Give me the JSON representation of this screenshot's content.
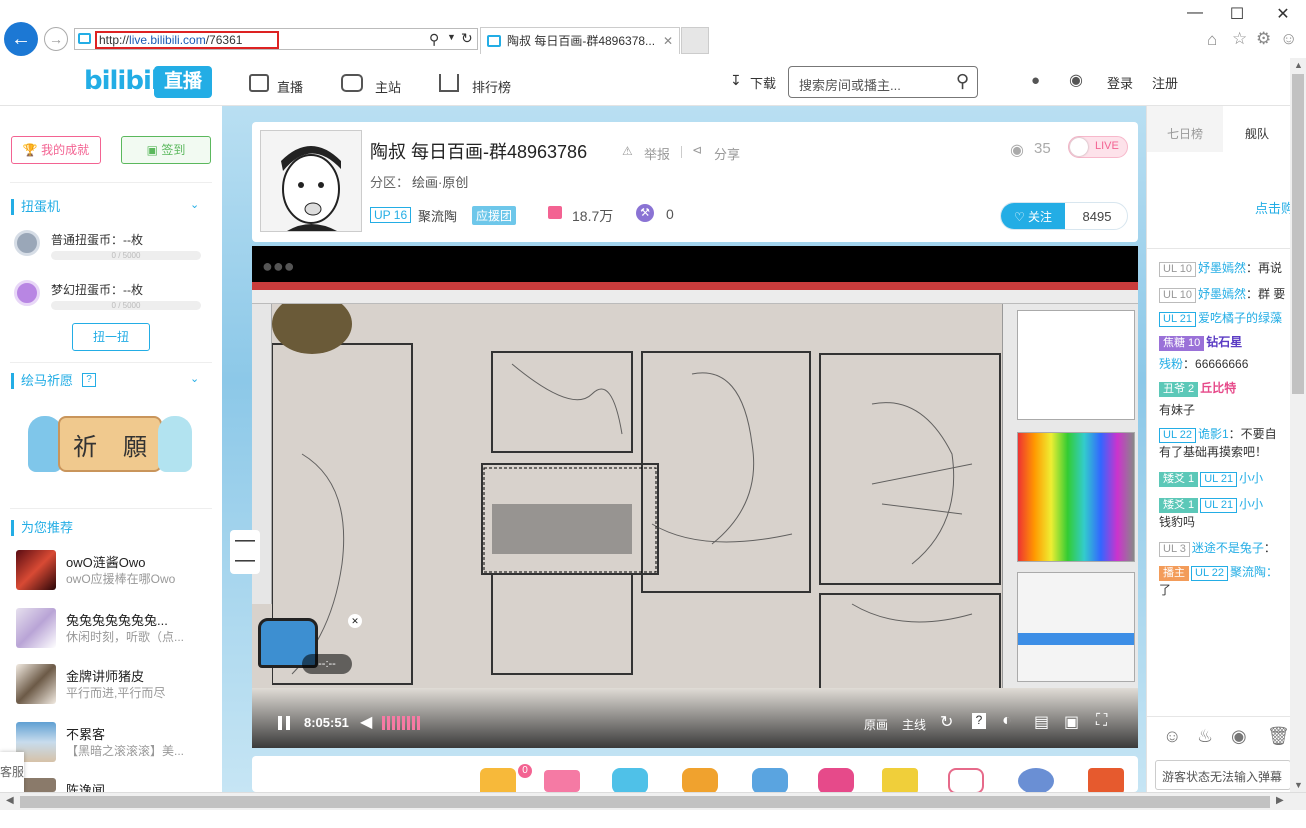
{
  "browser": {
    "url_prefix": "http://",
    "url_host": "live.bilibili.com",
    "url_path": "/76361",
    "tab_title": "陶叔 每日百画-群4896378...",
    "window_controls": [
      "—",
      "☐",
      "✕"
    ]
  },
  "header": {
    "logo_text": "bilibili",
    "logo_badge": "直播",
    "nav": [
      "直播",
      "主站",
      "排行榜"
    ],
    "download": "下载",
    "search_placeholder": "搜索房间或播主...",
    "login": "登录",
    "register": "注册"
  },
  "sidebar": {
    "achievements_button": "我的成就",
    "checkin_button": "签到",
    "gacha_title": "扭蛋机",
    "coins": [
      {
        "label": "普通扭蛋币：--枚",
        "progress_text": "0 / 5000",
        "progress": 0
      },
      {
        "label": "梦幻扭蛋币：--枚",
        "progress_text": "0 / 5000",
        "progress": 0
      }
    ],
    "twist_button": "扭一扭",
    "wish_title": "绘马祈愿",
    "wish_help": "?",
    "wish_plaque": [
      "祈",
      "願"
    ],
    "recommend_title": "为您推荐",
    "recommend": [
      {
        "name": "owO涟酱Owo",
        "sub": "owO应援棒在哪Owo"
      },
      {
        "name": "兔兔兔兔兔兔兔...",
        "sub": "休闲时刻，听歌（点..."
      },
      {
        "name": "金牌讲师猪皮",
        "sub": "平行而进,平行而尽"
      },
      {
        "name": "不累客",
        "sub": "【黑暗之滚滚滚】美..."
      },
      {
        "name": "陈逸闻",
        "sub": ""
      }
    ],
    "service_text": "客服"
  },
  "room": {
    "title": "陶叔 每日百画-群48963786",
    "report": "举报",
    "share": "分享",
    "category_label": "分区：",
    "category": "绘画·原创",
    "up_level": "UP 16",
    "up_name": "聚流陶",
    "guard_tag": "应援团",
    "gift_count": "18.7万",
    "tools_count": "0",
    "viewers": "35",
    "live_label": "LIVE",
    "follow_label": "关注",
    "follow_count": "8495"
  },
  "player": {
    "time": "8:05:51",
    "quality_buttons": [
      "原画",
      "主线"
    ],
    "chest_timer": "--:--",
    "gift_badge": "0"
  },
  "chat": {
    "tabs": [
      "七日榜",
      "舰队"
    ],
    "click_hint": "点击购",
    "messages": [
      {
        "badge": "UL 10",
        "user": "妤墨嫣然",
        "text": "：再说"
      },
      {
        "badge": "UL 10",
        "user": "妤墨嫣然",
        "text": "：群 要"
      },
      {
        "badge": "UL 21",
        "user": "爱吃橘子的绿藻",
        "text": ""
      },
      {
        "badge": "焦糖 10",
        "user": "",
        "text": "钻石星"
      },
      {
        "badge": "",
        "user": "残粉",
        "text": "：66666666"
      },
      {
        "badge": "丑爷 2",
        "user": "",
        "text": "丘比特"
      },
      {
        "badge": "",
        "user": "",
        "text": "有妹子"
      },
      {
        "badge": "UL 22",
        "user": "诡影1",
        "text": "：不要自"
      },
      {
        "badge": "",
        "user": "",
        "text": "有了基础再摸索吧！"
      },
      {
        "badge": "矮爻 1",
        "user": "UL 21",
        "text": "小小"
      },
      {
        "badge": "矮爻 1",
        "user": "UL 21",
        "text": "小小"
      },
      {
        "badge": "",
        "user": "",
        "text": "钱豹吗"
      },
      {
        "badge": "UL 3",
        "user": "迷途不是兔子",
        "text": "："
      },
      {
        "badge": "播主",
        "user": "UL 22",
        "text": "聚流陶："
      },
      {
        "badge": "",
        "user": "",
        "text": "了"
      }
    ],
    "input_placeholder": "游客状态无法输入弹幕"
  },
  "colors": {
    "brand": "#23ade5",
    "pink": "#f36392",
    "green": "#5bb85d"
  }
}
